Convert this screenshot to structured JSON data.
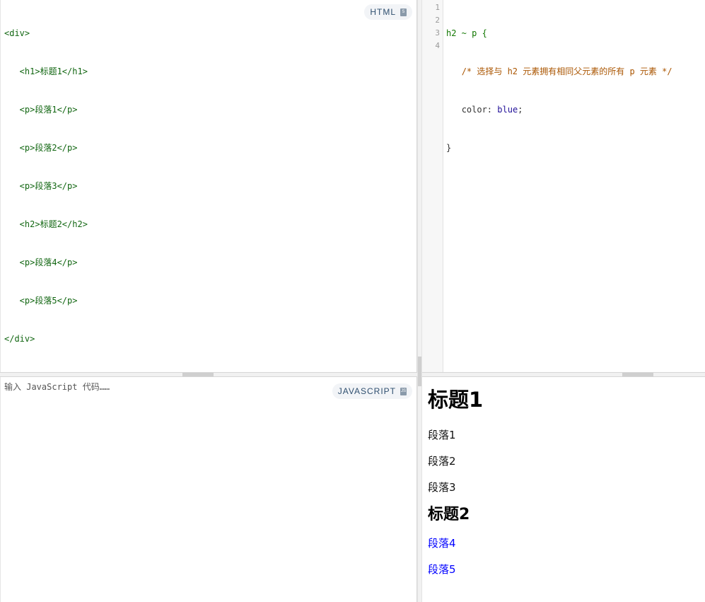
{
  "html_editor": {
    "badge_label": "HTML",
    "lines": [
      "<div>",
      "   <h1>标题1</h1>",
      "   <p>段落1</p>",
      "   <p>段落2</p>",
      "   <p>段落3</p>",
      "   <h2>标题2</h2>",
      "   <p>段落4</p>",
      "   <p>段落5</p>",
      "</div>"
    ]
  },
  "css_editor": {
    "line_numbers": [
      "1",
      "2",
      "3",
      "4"
    ],
    "selector": "h2 ~ p {",
    "comment": "/* 选择与 h2 元素拥有相同父元素的所有 p 元素 */",
    "property": "color: ",
    "value": "blue",
    "semicolon": ";",
    "close": "}"
  },
  "js_editor": {
    "badge_label": "JAVASCRIPT",
    "placeholder": "输入 JavaScript 代码……"
  },
  "result": {
    "h1": "标题1",
    "p1": "段落1",
    "p2": "段落2",
    "p3": "段落3",
    "h2": "标题2",
    "p4": "段落4",
    "p5": "段落5",
    "colors": {
      "sibling_paragraph": "#0000ff",
      "default_text": "#000000"
    }
  },
  "icons": {
    "html_badge": "html5-icon",
    "js_badge": "js-icon"
  }
}
